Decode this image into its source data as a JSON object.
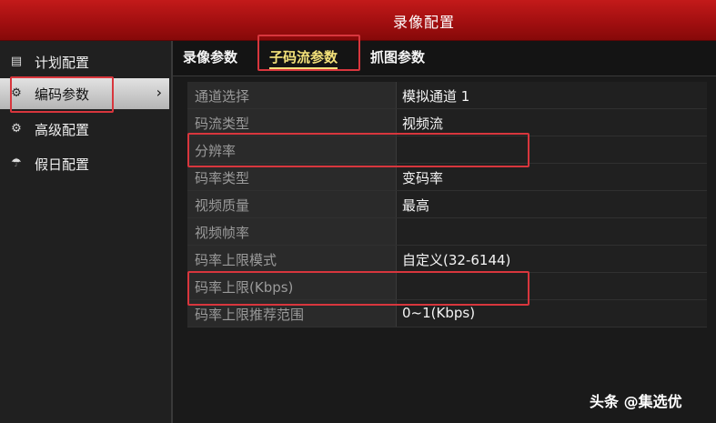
{
  "window": {
    "title": "录像配置"
  },
  "sidebar": {
    "items": [
      {
        "label": "计划配置",
        "icon": "calendar-icon"
      },
      {
        "label": "编码参数",
        "icon": "gear-icon",
        "active": true
      },
      {
        "label": "高级配置",
        "icon": "gears-icon"
      },
      {
        "label": "假日配置",
        "icon": "umbrella-icon"
      }
    ]
  },
  "tabs": [
    {
      "label": "录像参数"
    },
    {
      "label": "子码流参数",
      "active": true
    },
    {
      "label": "抓图参数"
    }
  ],
  "form": {
    "rows": [
      {
        "label": "通道选择",
        "value": "模拟通道 1"
      },
      {
        "label": "码流类型",
        "value": "视频流"
      },
      {
        "label": "分辨率",
        "value": ""
      },
      {
        "label": "码率类型",
        "value": "变码率"
      },
      {
        "label": "视频质量",
        "value": "最高"
      },
      {
        "label": "视频帧率",
        "value": ""
      },
      {
        "label": "码率上限模式",
        "value": "自定义(32-6144)"
      },
      {
        "label": "码率上限(Kbps)",
        "value": ""
      },
      {
        "label": "码率上限推荐范围",
        "value": "0~1(Kbps)"
      }
    ]
  },
  "watermark": "头条 @集选优",
  "colors": {
    "titlebar": "#a20f10",
    "highlight": "#d8363d",
    "active_tab": "#f4e27a"
  }
}
